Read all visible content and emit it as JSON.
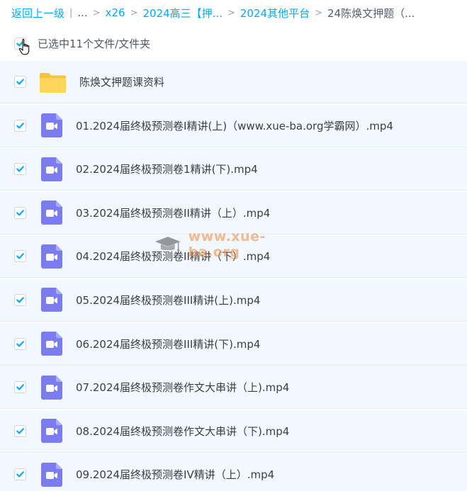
{
  "breadcrumb": {
    "back": "返回上一级",
    "ellipsis": "...",
    "items": [
      "x26",
      "2024高三【押...",
      "2024其他平台"
    ],
    "current": "24陈焕文押题（..."
  },
  "selection": {
    "text": "已选中11个文件/文件夹",
    "checked": true
  },
  "files": [
    {
      "name": "陈焕文押题课资料",
      "type": "folder",
      "checked": true
    },
    {
      "name": "01.2024届终极预测卷I精讲(上)（www.xue-ba.org学霸网）.mp4",
      "type": "video",
      "checked": true
    },
    {
      "name": "02.2024届终极预测卷1精讲(下).mp4",
      "type": "video",
      "checked": true
    },
    {
      "name": "03.2024届终极预测卷II精讲（上）.mp4",
      "type": "video",
      "checked": true
    },
    {
      "name": "04.2024届终极预测卷II精讲（下）.mp4",
      "type": "video",
      "checked": true
    },
    {
      "name": "05.2024届终极预测卷III精讲(上).mp4",
      "type": "video",
      "checked": true
    },
    {
      "name": "06.2024届终极预测卷III精讲(下).mp4",
      "type": "video",
      "checked": true
    },
    {
      "name": "07.2024届终极预测卷作文大串讲（上).mp4",
      "type": "video",
      "checked": true
    },
    {
      "name": "08.2024届终极预测卷作文大串讲（下).mp4",
      "type": "video",
      "checked": true
    },
    {
      "name": "09.2024届终极预测卷IV精讲（上）.mp4",
      "type": "video",
      "checked": true
    }
  ],
  "watermark": {
    "text": "www.xue-ba.org"
  },
  "colors": {
    "accent": "#06a7ff",
    "video_icon": "#7b7cf2",
    "folder_icon": "#ffd04a",
    "row_bg": "#f2f8ff"
  }
}
